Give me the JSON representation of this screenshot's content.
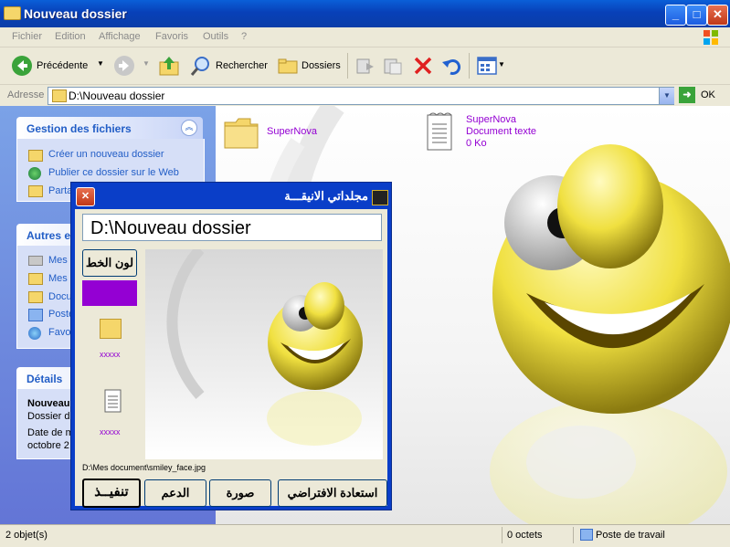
{
  "window": {
    "title": "Nouveau dossier"
  },
  "menu": {
    "items": [
      "Fichier",
      "Edition",
      "Affichage",
      "Favoris",
      "Outils",
      "?"
    ]
  },
  "toolbar": {
    "back_label": "Précédente",
    "search_label": "Rechercher",
    "folders_label": "Dossiers"
  },
  "address": {
    "label": "Adresse",
    "value": "D:\\Nouveau dossier",
    "go_label": "OK"
  },
  "sidebar": {
    "tasks": {
      "title": "Gestion des fichiers",
      "items": [
        "Créer un nouveau dossier",
        "Publier ce dossier sur le Web",
        "Partager ce dossier"
      ]
    },
    "places": {
      "title": "Autres emplacements",
      "items": [
        "Mes Documents",
        "Mes documents partagés",
        "Documents partagés",
        "Poste de travail",
        "Favoris réseau"
      ]
    },
    "details": {
      "title": "Détails",
      "name": "Nouveau dossier",
      "type": "Dossier de fichiers",
      "date_line1": "Date de modification :",
      "date_line2": "octobre 2"
    }
  },
  "files": [
    {
      "name": "SuperNova",
      "line2": "",
      "line3": ""
    },
    {
      "name": "SuperNova",
      "line2": "Document texte",
      "line3": "0 Ko"
    }
  ],
  "dialog": {
    "title": "مجلداتي الانيقـــة",
    "path_value": "D:\\Nouveau dossier",
    "font_color_label": "لون الخط",
    "font_color": "#9400d3",
    "folder_sample_label": "xxxxx",
    "file_sample_label": "xxxxx",
    "image_path": "D:\\Mes document\\smiley_face.jpg",
    "buttons": {
      "execute": "تنفيــذ",
      "support": "الدعم",
      "image": "صورة",
      "restore": "استعادة الافتراضي"
    }
  },
  "status": {
    "objects": "2 objet(s)",
    "size": "0 octets",
    "location": "Poste de travail"
  },
  "colors": {
    "file_label": "#9400d3",
    "xp_blue": "#0a5fd8"
  }
}
